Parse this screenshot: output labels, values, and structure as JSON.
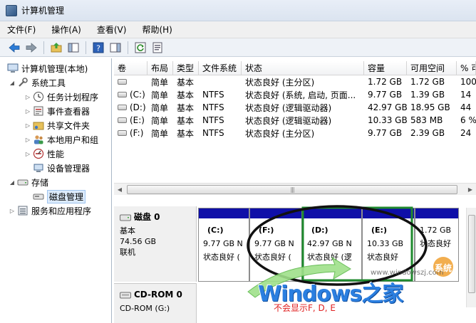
{
  "window": {
    "title": "计算机管理"
  },
  "menu": [
    "文件(F)",
    "操作(A)",
    "查看(V)",
    "帮助(H)"
  ],
  "tree": [
    {
      "label": "计算机管理(本地)",
      "level": 0,
      "arrow": "",
      "icon": "computer-management-icon"
    },
    {
      "label": "系统工具",
      "level": 1,
      "arrow": "◢",
      "icon": "system-tools-icon"
    },
    {
      "label": "任务计划程序",
      "level": 2,
      "arrow": "▷",
      "icon": "task-scheduler-icon"
    },
    {
      "label": "事件查看器",
      "level": 2,
      "arrow": "▷",
      "icon": "event-viewer-icon"
    },
    {
      "label": "共享文件夹",
      "level": 2,
      "arrow": "▷",
      "icon": "shared-folders-icon"
    },
    {
      "label": "本地用户和组",
      "level": 2,
      "arrow": "▷",
      "icon": "local-users-icon"
    },
    {
      "label": "性能",
      "level": 2,
      "arrow": "▷",
      "icon": "performance-icon"
    },
    {
      "label": "设备管理器",
      "level": 2,
      "arrow": "",
      "icon": "device-manager-icon"
    },
    {
      "label": "存储",
      "level": 1,
      "arrow": "◢",
      "icon": "storage-icon"
    },
    {
      "label": "磁盘管理",
      "level": 2,
      "arrow": "",
      "icon": "disk-management-icon",
      "selected": true
    },
    {
      "label": "服务和应用程序",
      "level": 1,
      "arrow": "▷",
      "icon": "services-apps-icon"
    }
  ],
  "volumes": {
    "headers": [
      "卷",
      "布局",
      "类型",
      "文件系统",
      "状态",
      "容量",
      "可用空间",
      "% 可"
    ],
    "rows": [
      [
        "",
        "简单",
        "基本",
        "",
        "状态良好 (主分区)",
        "1.72 GB",
        "1.72 GB",
        "100"
      ],
      [
        "(C:)",
        "简单",
        "基本",
        "NTFS",
        "状态良好 (系统, 启动, 页面...",
        "9.77 GB",
        "1.39 GB",
        "14"
      ],
      [
        "(D:)",
        "简单",
        "基本",
        "NTFS",
        "状态良好 (逻辑驱动器)",
        "42.97 GB",
        "18.95 GB",
        "44"
      ],
      [
        "(E:)",
        "简单",
        "基本",
        "NTFS",
        "状态良好 (逻辑驱动器)",
        "10.33 GB",
        "583 MB",
        "6 %"
      ],
      [
        "(F:)",
        "简单",
        "基本",
        "NTFS",
        "状态良好 (主分区)",
        "9.77 GB",
        "2.39 GB",
        "24"
      ]
    ]
  },
  "disk0": {
    "name": "磁盘 0",
    "type": "基本",
    "size": "74.56 GB",
    "status": "联机",
    "partitions": [
      {
        "name": "(C:)",
        "line1": "9.77 GB N",
        "line2": "状态良好 ("
      },
      {
        "name": "(F:)",
        "line1": "9.77 GB N",
        "line2": "状态良好 ("
      },
      {
        "name": "(D:)",
        "line1": "42.97 GB N",
        "line2": "状态良好 (逻"
      },
      {
        "name": "(E:)",
        "line1": "10.33 GB",
        "line2": "状态良好"
      },
      {
        "name": "",
        "line1": "1.72 GB",
        "line2": "状态良好"
      }
    ]
  },
  "cdrom": {
    "name": "CD-ROM 0",
    "line": "CD-ROM (G:)"
  },
  "watermark": {
    "brand": "Windows之家",
    "site": "www.windowszj.com",
    "badge": "系统",
    "note": "不会显示F, D, E"
  }
}
